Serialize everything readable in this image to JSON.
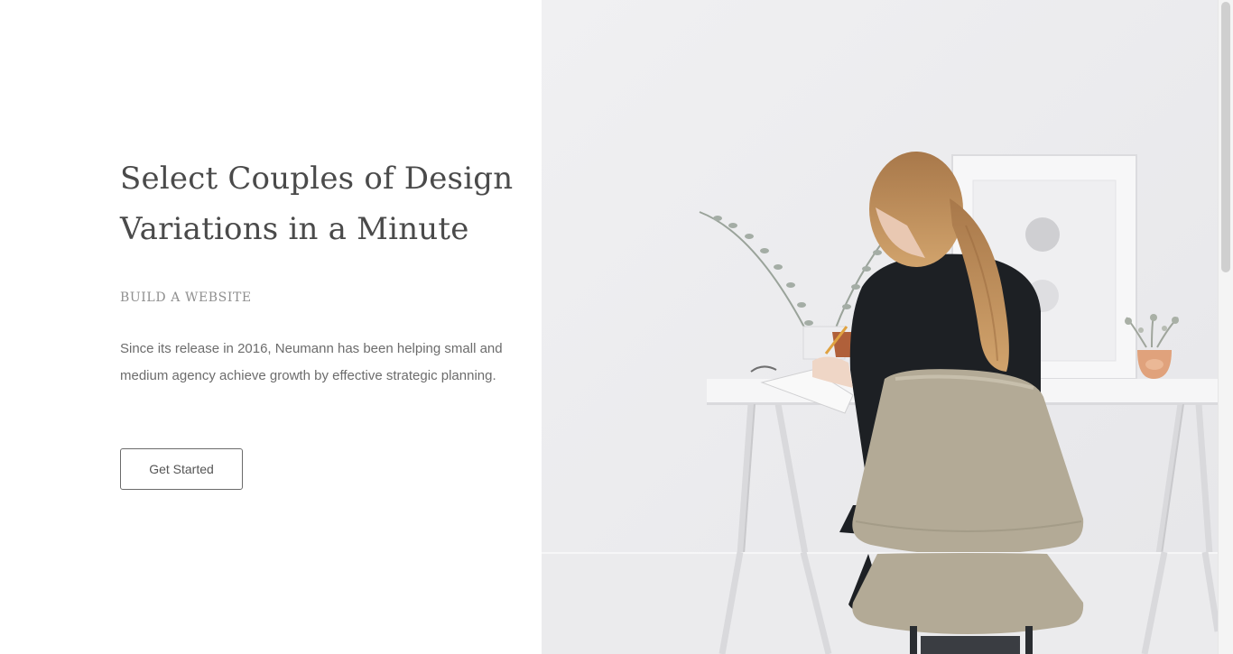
{
  "hero": {
    "headline_line1": "Select Couples of Design",
    "headline_line2": "Variations in a Minute",
    "subtitle": "BUILD A WEBSITE",
    "description": "Since its release in 2016, Neumann has been helping small and medium agency achieve growth by effective strategic planning.",
    "cta_label": "Get Started"
  },
  "colors": {
    "text_dark": "#4a4a4a",
    "text_muted": "#8f8f8f",
    "photo_wall": "#ececee",
    "chair": "#b3aa96",
    "sweater": "#1d2024",
    "hair": "#b9874f"
  }
}
